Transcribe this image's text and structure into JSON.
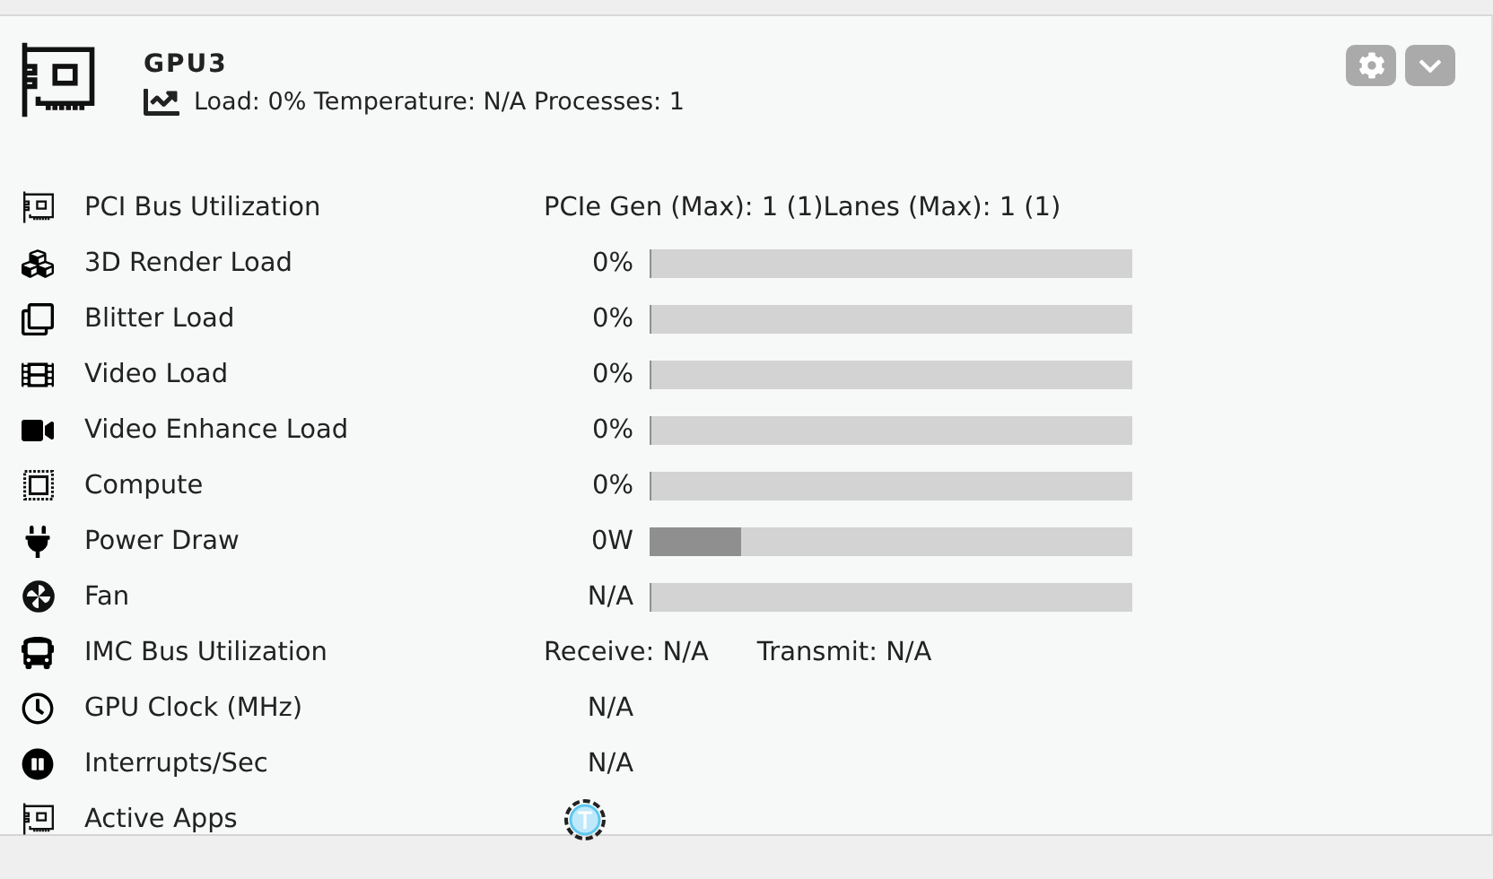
{
  "card": {
    "title": "GPU3",
    "summary": "Load: 0% Temperature: N/A Processes: 1"
  },
  "rows": [
    {
      "kind": "info",
      "label": "PCI Bus Utilization",
      "parts": [
        "PCIe Gen (Max): 1 (1)Lanes (Max): 1 (1)"
      ]
    },
    {
      "kind": "bar",
      "label": "3D Render Load",
      "value": "0%",
      "level": 0
    },
    {
      "kind": "bar",
      "label": "Blitter Load",
      "value": "0%",
      "level": 0
    },
    {
      "kind": "bar",
      "label": "Video Load",
      "value": "0%",
      "level": 0
    },
    {
      "kind": "bar",
      "label": "Video Enhance Load",
      "value": "0%",
      "level": 0
    },
    {
      "kind": "bar",
      "label": "Compute",
      "value": "0%",
      "level": 0
    },
    {
      "kind": "bar",
      "label": "Power Draw",
      "value": "0W",
      "level": 0.19
    },
    {
      "kind": "bar",
      "label": "Fan",
      "value": "N/A",
      "level": 0
    },
    {
      "kind": "info",
      "label": "IMC Bus Utilization",
      "parts": [
        "Receive: N/A",
        "Transmit: N/A"
      ]
    },
    {
      "kind": "value",
      "label": "GPU Clock (MHz)",
      "value": "N/A"
    },
    {
      "kind": "value",
      "label": "Interrupts/Sec",
      "value": "N/A"
    },
    {
      "kind": "apps",
      "label": "Active Apps"
    }
  ]
}
